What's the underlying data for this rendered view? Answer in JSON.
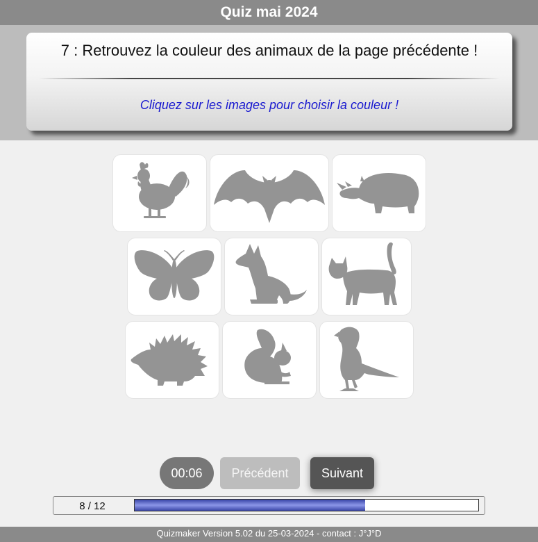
{
  "app": {
    "title": "Quiz mai 2024"
  },
  "question": {
    "text": "7 : Retrouvez la couleur des animaux de la page précédente !",
    "instruction": "Cliquez sur les images pour choisir la couleur !"
  },
  "animals": [
    {
      "name": "rooster",
      "icon": "rooster-icon"
    },
    {
      "name": "bat",
      "icon": "bat-icon"
    },
    {
      "name": "rhinoceros",
      "icon": "rhinoceros-icon"
    },
    {
      "name": "butterfly",
      "icon": "butterfly-icon"
    },
    {
      "name": "dog",
      "icon": "dog-icon"
    },
    {
      "name": "cat",
      "icon": "cat-icon"
    },
    {
      "name": "hedgehog",
      "icon": "hedgehog-icon"
    },
    {
      "name": "squirrel",
      "icon": "squirrel-icon"
    },
    {
      "name": "bird",
      "icon": "bird-icon"
    }
  ],
  "controls": {
    "timer": "00:06",
    "previous_label": "Précédent",
    "next_label": "Suivant"
  },
  "progress": {
    "label": "8 / 12",
    "fraction": 0.67
  },
  "footer": {
    "text": "Quizmaker Version 5.02 du 25-03-2024 - contact : J°J°D"
  },
  "colors": {
    "title_bar": "#8a8a8a",
    "header_band": "#bcbcbc",
    "instruction_text": "#1a1ad0",
    "silhouette": "#949494",
    "progress_fill": "#3a46a8"
  }
}
